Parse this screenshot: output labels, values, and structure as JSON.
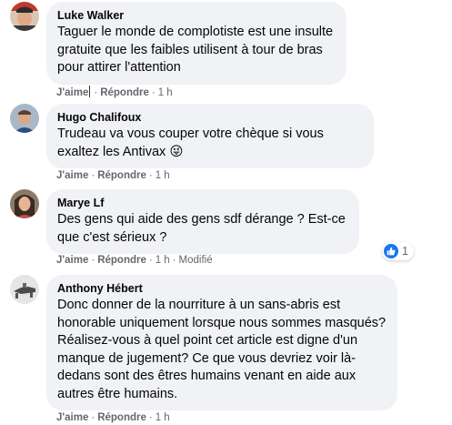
{
  "colors": {
    "bubble_bg": "#f0f2f5",
    "meta_text": "#65676b",
    "like_blue": "#1877f2"
  },
  "comments": [
    {
      "author": "Luke Walker",
      "text": "Taguer le monde de complotiste est une insulte gratuite que les faibles utilisent à tour de bras pour attirer l'attention",
      "like_label": "J'aime",
      "reply_label": "Répondre",
      "time": "1 h",
      "avatar_icon": "profile-photo"
    },
    {
      "author": "Hugo Chalifoux",
      "text": "Trudeau va vous couper votre chèque si vous exaltez les Antivax",
      "emoji": "😜",
      "like_label": "J'aime",
      "reply_label": "Répondre",
      "time": "1 h",
      "avatar_icon": "profile-photo"
    },
    {
      "author": "Marye Lf",
      "text": "Des gens qui aide des gens sdf dérange ? Est-ce que c'est sérieux ?",
      "like_label": "J'aime",
      "reply_label": "Répondre",
      "time": "1 h",
      "edited_label": "Modifié",
      "reaction_count": "1",
      "reaction_icon": "like-icon",
      "avatar_icon": "profile-photo"
    },
    {
      "author": "Anthony Hébert",
      "text": "Donc donner de la nourriture à un sans-abris est honorable uniquement lorsque nous sommes masqués? Réalisez-vous à quel point cet article est digne d'un manque de jugement? Ce que vous devriez voir là-dedans sont des êtres humains venant en aide aux autres être humains.",
      "like_label": "J'aime",
      "reply_label": "Répondre",
      "time": "1 h",
      "avatar_icon": "profile-photo"
    }
  ]
}
